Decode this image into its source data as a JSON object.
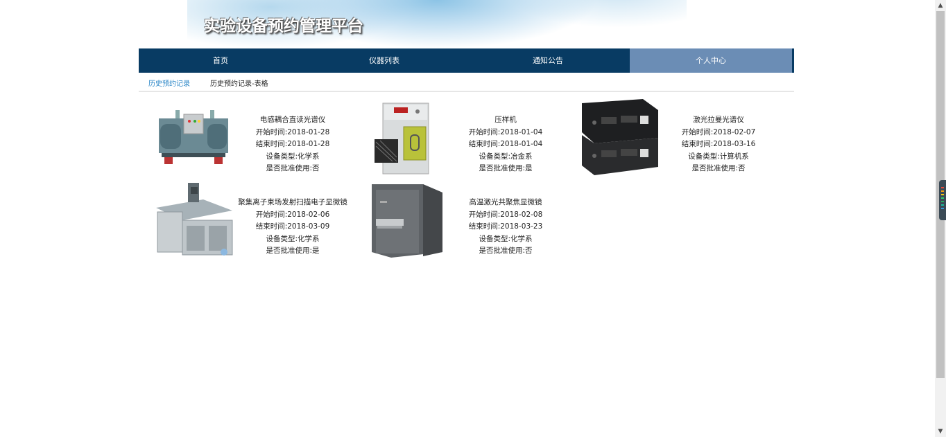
{
  "site": {
    "title": "实验设备预约管理平台"
  },
  "nav": {
    "items": [
      {
        "label": "首页",
        "active": false
      },
      {
        "label": "仪器列表",
        "active": false
      },
      {
        "label": "通知公告",
        "active": false
      },
      {
        "label": "个人中心",
        "active": true
      }
    ]
  },
  "subtabs": {
    "history": "历史预约记录",
    "history_table": "历史预约记录-表格"
  },
  "records": [
    {
      "name": "电感耦合直读光谱仪",
      "start": "开始时间:2018-01-28",
      "end": "结束时间:2018-01-28",
      "type": "设备类型:化学系",
      "approved": "是否批准使用:否",
      "image": "cooling-unit-image"
    },
    {
      "name": "压样机",
      "start": "开始时间:2018-01-04",
      "end": "结束时间:2018-01-04",
      "type": "设备类型:冶金系",
      "approved": "是否批准使用:是",
      "image": "press-machine-image"
    },
    {
      "name": "激光拉曼光谱仪",
      "start": "开始时间:2018-02-07",
      "end": "结束时间:2018-03-16",
      "type": "设备类型:计算机系",
      "approved": "是否批准使用:否",
      "image": "kvm-switch-image"
    },
    {
      "name": "聚集离子束场发射扫描电子显微镜",
      "start": "开始时间:2018-02-06",
      "end": "结束时间:2018-03-09",
      "type": "设备类型:化学系",
      "approved": "是否批准使用:是",
      "image": "industrial-table-image"
    },
    {
      "name": "高温激光共聚焦显微镜",
      "start": "开始时间:2018-02-08",
      "end": "结束时间:2018-03-23",
      "type": "设备类型:化学系",
      "approved": "是否批准使用:否",
      "image": "cabinet-device-image"
    }
  ],
  "colors": {
    "nav_bg": "#083b63",
    "nav_active": "#6b8db5",
    "link": "#2a86c7"
  }
}
